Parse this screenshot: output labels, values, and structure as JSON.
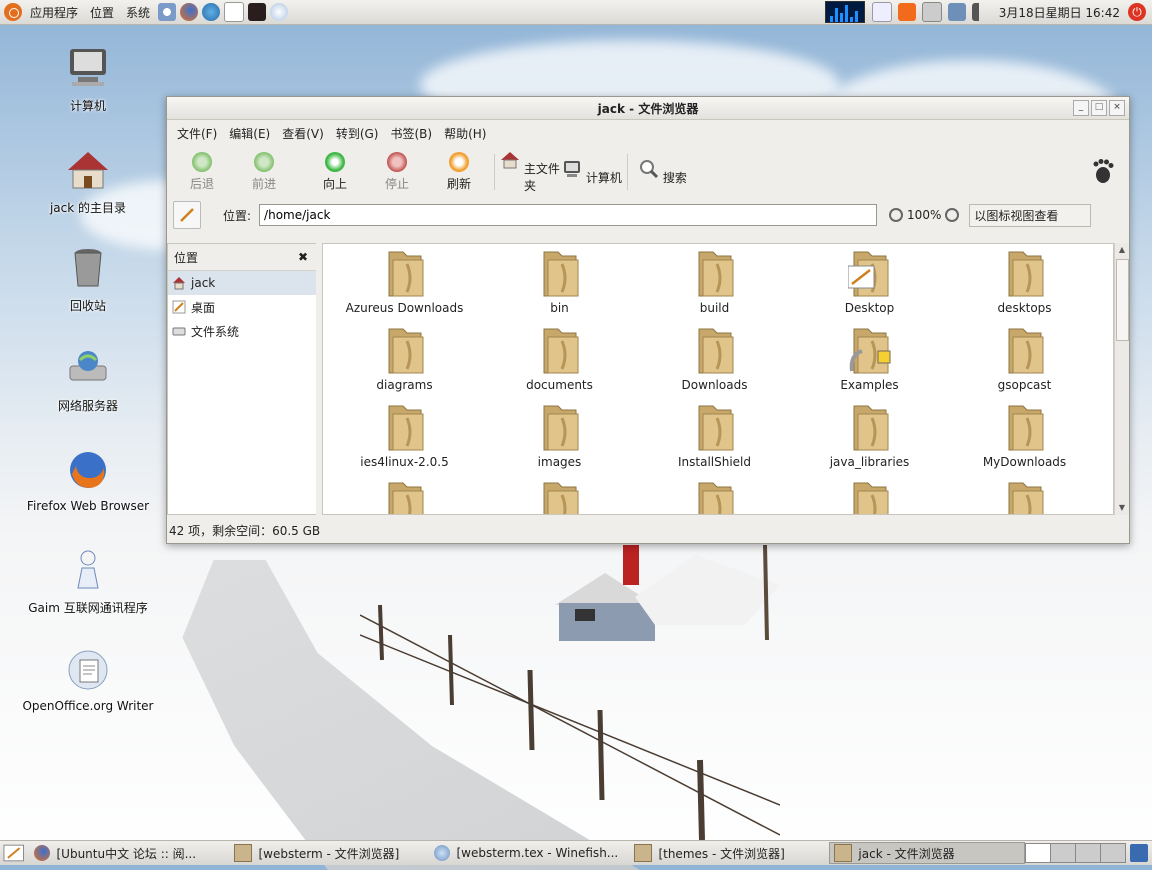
{
  "top_panel": {
    "menus": [
      "应用程序",
      "位置",
      "系统"
    ],
    "launchers": [
      "help-icon",
      "firefox-icon",
      "network-icon",
      "text-editor-icon",
      "terminal-icon",
      "media-icon"
    ],
    "clock": "3月18日星期日 16:42"
  },
  "desktop": {
    "icons": [
      {
        "label": "计算机",
        "icon": "computer-icon"
      },
      {
        "label": "jack 的主目录",
        "icon": "home-icon"
      },
      {
        "label": "回收站",
        "icon": "trash-icon"
      },
      {
        "label": "网络服务器",
        "icon": "network-server-icon"
      },
      {
        "label": "Firefox Web Browser",
        "icon": "firefox-icon"
      },
      {
        "label": "Gaim 互联网通讯程序",
        "icon": "gaim-icon"
      },
      {
        "label": "OpenOffice.org Writer",
        "icon": "writer-icon"
      }
    ]
  },
  "window": {
    "title": "jack - 文件浏览器",
    "menu": [
      "文件(F)",
      "编辑(E)",
      "查看(V)",
      "转到(G)",
      "书签(B)",
      "帮助(H)"
    ],
    "toolbar": [
      {
        "label": "后退",
        "icon": "back-icon",
        "enabled": false,
        "color": "#7fbf6a"
      },
      {
        "label": "前进",
        "icon": "forward-icon",
        "enabled": false,
        "color": "#7fbf6a"
      },
      {
        "label": "向上",
        "icon": "up-icon",
        "enabled": true,
        "color": "#3cb843"
      },
      {
        "label": "停止",
        "icon": "stop-icon",
        "enabled": false,
        "color": "#c0504d"
      },
      {
        "label": "刷新",
        "icon": "reload-icon",
        "enabled": true,
        "color": "#f0a030"
      },
      {
        "label": "主文件夹",
        "icon": "home-icon",
        "enabled": true,
        "color": "#8a6a4a"
      },
      {
        "label": "计算机",
        "icon": "computer-icon",
        "enabled": true,
        "color": "#555555"
      },
      {
        "label": "搜索",
        "icon": "search-icon",
        "enabled": true,
        "color": "#888888"
      }
    ],
    "location_label": "位置:",
    "location_value": "/home/jack",
    "zoom": "100%",
    "view_mode": "以图标视图查看",
    "side_pane": {
      "title": "位置",
      "items": [
        {
          "label": "jack",
          "icon": "home-icon"
        },
        {
          "label": "桌面",
          "icon": "desktop-icon"
        },
        {
          "label": "文件系统",
          "icon": "drive-icon"
        }
      ]
    },
    "files": [
      "Azureus Downloads",
      "bin",
      "build",
      "Desktop",
      "desktops",
      "diagrams",
      "documents",
      "Downloads",
      "Examples",
      "gsopcast",
      "ies4linux-2.0.5",
      "images",
      "InstallShield",
      "java_libraries",
      "MyDownloads",
      "",
      "",
      "",
      "",
      ""
    ],
    "status": "42 项，剩余空间：60.5 GB"
  },
  "bottom_panel": {
    "tasks": [
      {
        "label": "[Ubuntu中文 论坛 :: 阅...",
        "icon": "firefox-icon",
        "active": false
      },
      {
        "label": "[websterm - 文件浏览器]",
        "icon": "folder-icon",
        "active": false
      },
      {
        "label": "[websterm.tex - Winefish...",
        "icon": "editor-icon",
        "active": false
      },
      {
        "label": "[themes - 文件浏览器]",
        "icon": "folder-icon",
        "active": false
      },
      {
        "label": "jack - 文件浏览器",
        "icon": "folder-icon",
        "active": true
      }
    ]
  }
}
